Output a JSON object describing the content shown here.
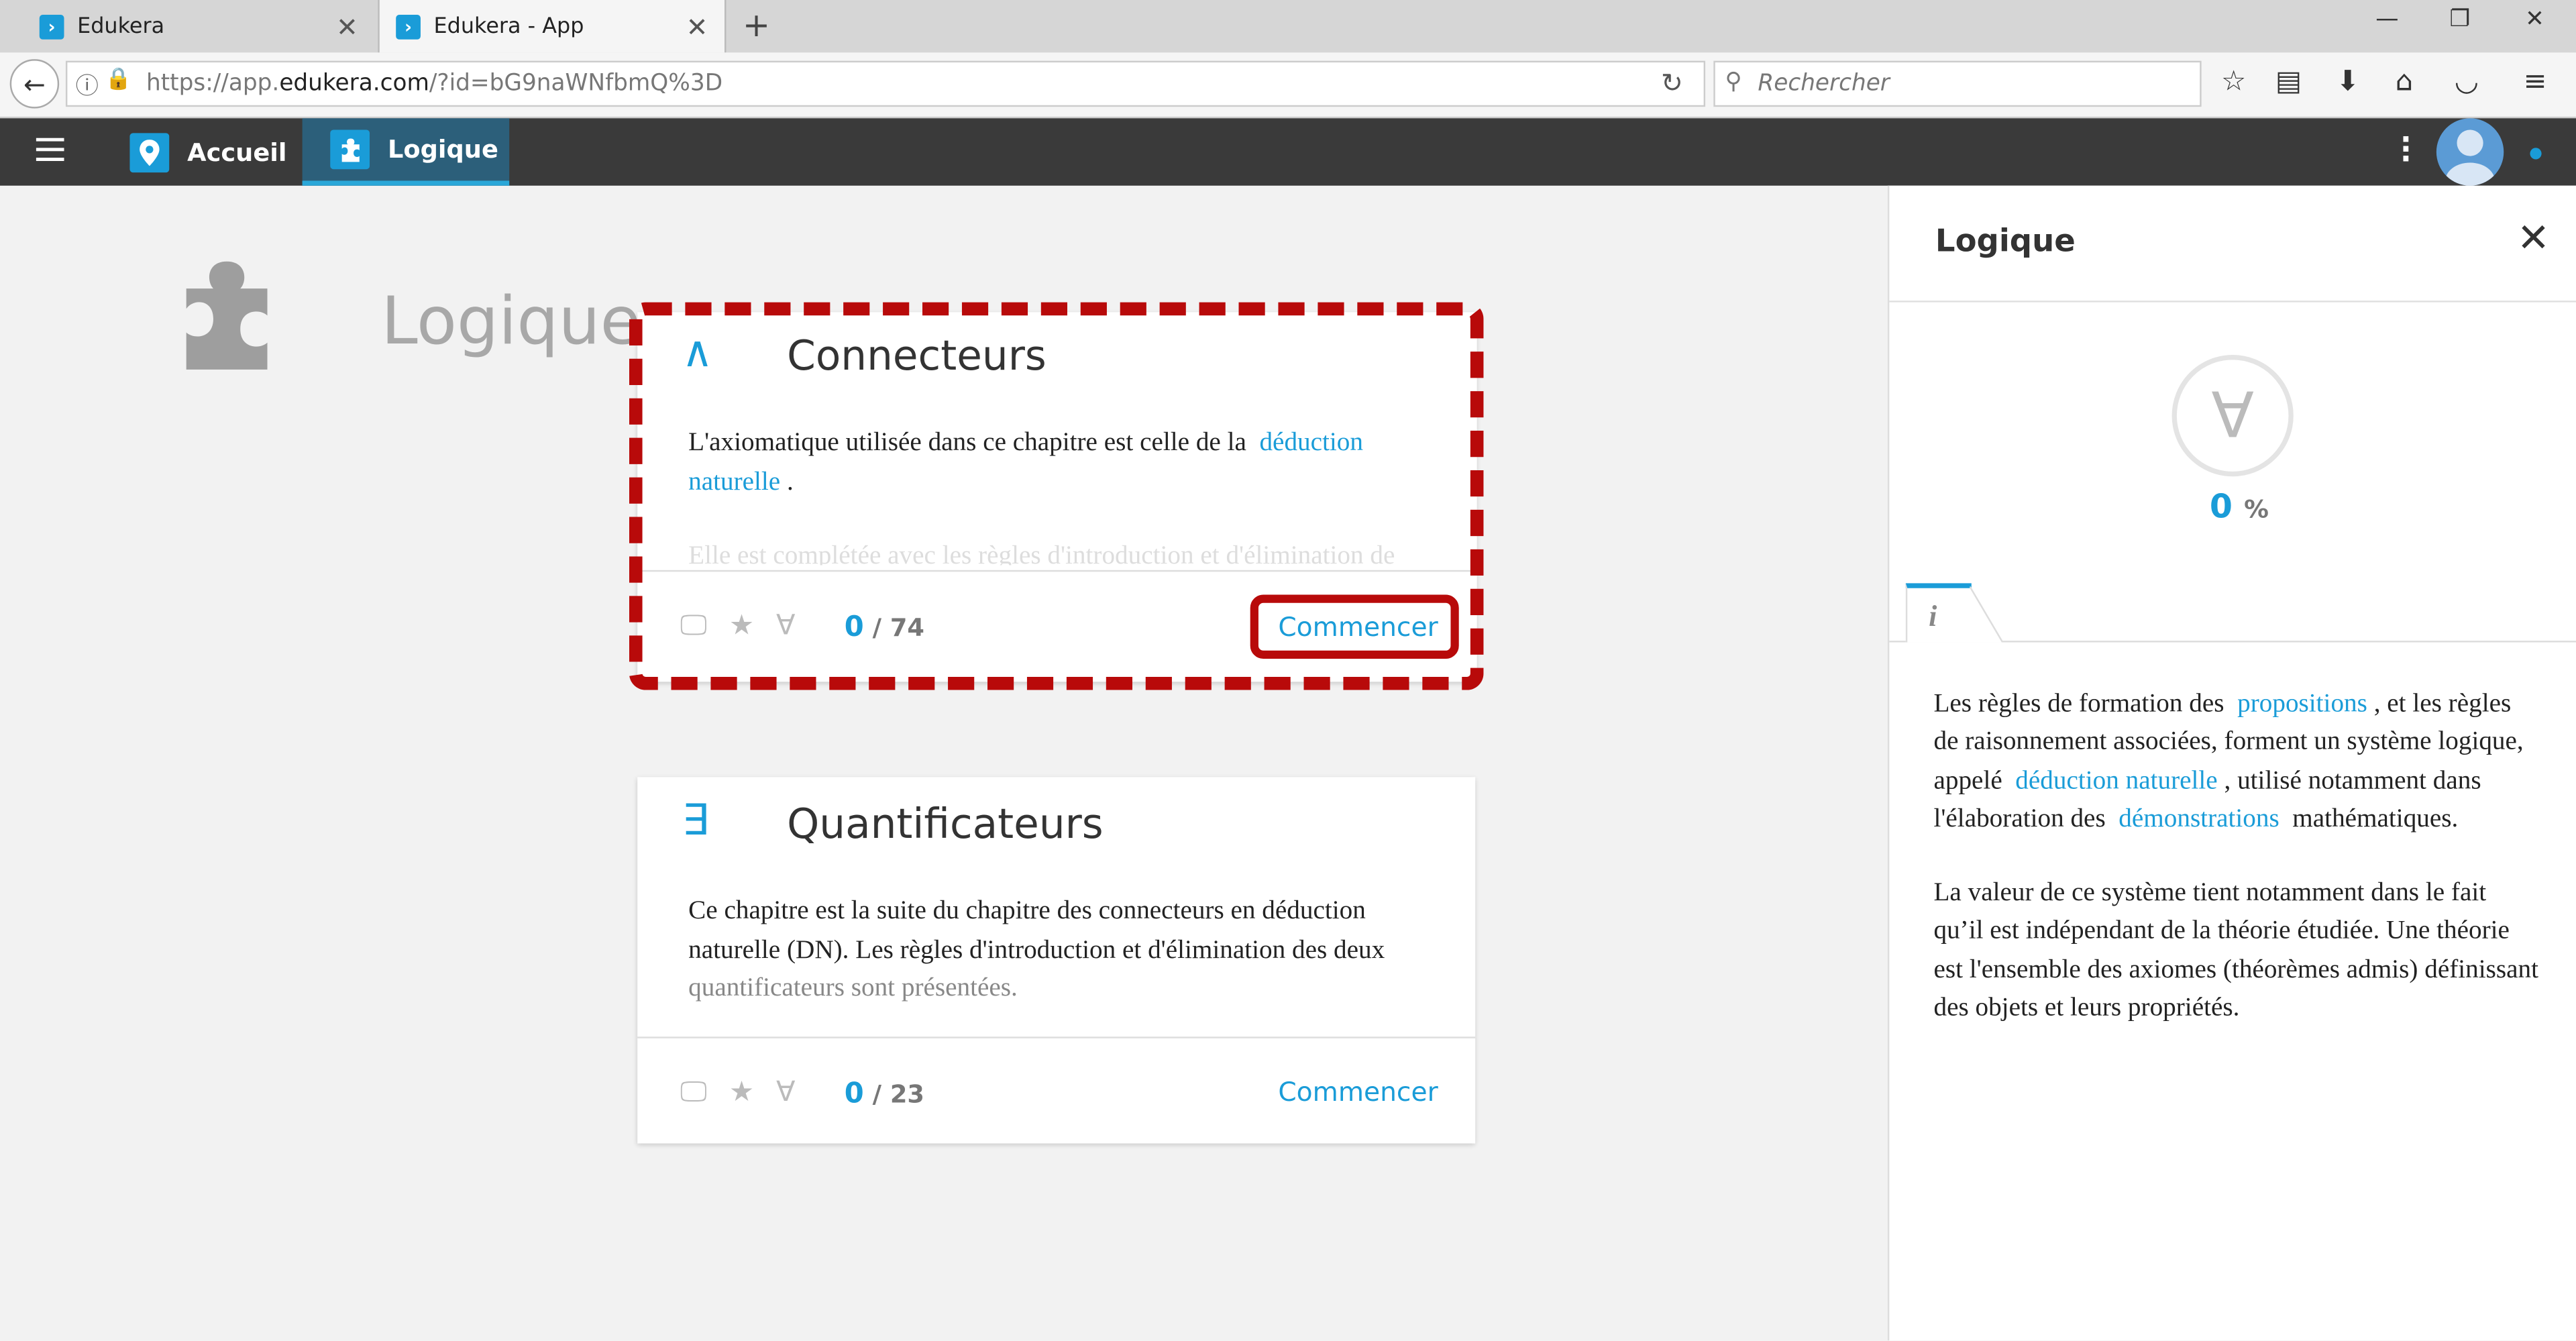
{
  "browser": {
    "tabs": [
      {
        "label": "Edukera"
      },
      {
        "label": "Edukera - App"
      }
    ],
    "url_prefix": "https://app.",
    "url_domain": "edukera.com",
    "url_suffix": "/?id=bG9naWNfbmQ%3D",
    "search_placeholder": "Rechercher"
  },
  "app": {
    "nav": [
      {
        "label": "Accueil",
        "icon": "location-pin-icon"
      },
      {
        "label": "Logique",
        "icon": "puzzle-icon"
      }
    ]
  },
  "page": {
    "title": "Logique",
    "icon": "puzzle-icon"
  },
  "cards": [
    {
      "symbol": "∧",
      "title": "Connecteurs",
      "desc_text_1": "L'axiomatique utilisée dans ce chapitre est celle de la",
      "desc_link_1": "déduction naturelle",
      "desc_text_2": ".",
      "desc_faded": "Elle est complétée avec les règles d'introduction et d'élimination de",
      "progress_done": "0",
      "progress_total": "/ 74",
      "button": "Commencer"
    },
    {
      "symbol": "∃",
      "title": "Quantificateurs",
      "desc_text_1": "Ce chapitre est la suite du chapitre des connecteurs en déduction naturelle (DN). Les règles d'introduction et d'élimination des deux",
      "desc_faded": "quantificateurs sont présentées.",
      "progress_done": "0",
      "progress_total": "/ 23",
      "button": "Commencer"
    }
  ],
  "panel": {
    "title": "Logique",
    "symbol": "∀",
    "percent_value": "0",
    "percent_unit": "%",
    "tab_label": "i",
    "para1": {
      "t1": "Les règles de formation des",
      "l1": "propositions",
      "t2": ", et les règles de raisonnement associées, forment un système logique, appelé",
      "l2": "déduction naturelle",
      "t3": ", utilisé notamment dans l'élaboration des",
      "l3": "démonstrations",
      "t4": "mathématiques."
    },
    "para2": "La valeur de ce système tient notamment dans le fait qu’il est indépendant de la théorie étudiée. Une théorie est l'ensemble des axiomes (théorèmes admis) définissant des objets et leurs propriétés."
  },
  "colors": {
    "accent": "#1a9cd8",
    "highlight_red": "#b80a0a",
    "header_dark": "#3a3a3a"
  }
}
